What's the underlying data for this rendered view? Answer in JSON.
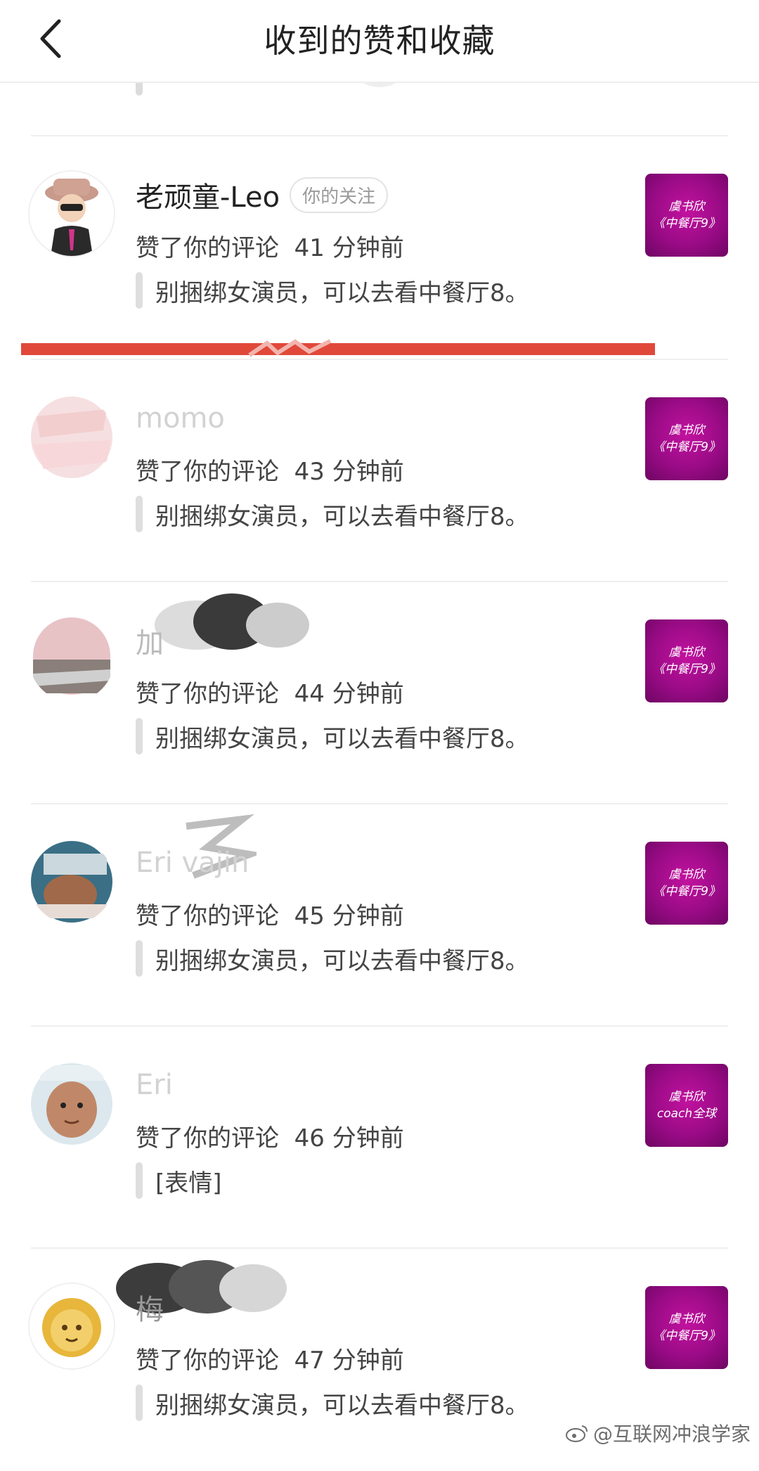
{
  "header": {
    "title": "收到的赞和收藏"
  },
  "top_remnant": {
    "quote_text": ""
  },
  "notifications": [
    {
      "username": "老顽童-Leo",
      "badge": "你的关注",
      "action": "赞了你的评论",
      "time": "41 分钟前",
      "quote": "别捆绑女演员，可以去看中餐厅8。",
      "thumb_lines": [
        "虞书欣",
        "《中餐厅9》"
      ]
    },
    {
      "username": "momo",
      "badge": "",
      "action": "赞了你的评论",
      "time": "43 分钟前",
      "quote": "别捆绑女演员，可以去看中餐厅8。",
      "thumb_lines": [
        "虞书欣",
        "《中餐厅9》"
      ]
    },
    {
      "username": "加",
      "badge": "",
      "action": "赞了你的评论",
      "time": "44 分钟前",
      "quote": "别捆绑女演员，可以去看中餐厅8。",
      "thumb_lines": [
        "虞书欣",
        "《中餐厅9》"
      ]
    },
    {
      "username": "Eri    vajin",
      "badge": "",
      "action": "赞了你的评论",
      "time": "45 分钟前",
      "quote": "别捆绑女演员，可以去看中餐厅8。",
      "thumb_lines": [
        "虞书欣",
        "《中餐厅9》"
      ]
    },
    {
      "username": "Eri",
      "badge": "",
      "action": "赞了你的评论",
      "time": "46 分钟前",
      "quote": "[表情]",
      "thumb_lines": [
        "虞书欣",
        "coach全球"
      ]
    },
    {
      "username": "梅",
      "badge": "",
      "action": "赞了你的评论",
      "time": "47 分钟前",
      "quote": "别捆绑女演员，可以去看中餐厅8。",
      "thumb_lines": [
        "虞书欣",
        "《中餐厅9》"
      ]
    }
  ],
  "watermark": {
    "text": "@互联网冲浪学家"
  },
  "colors": {
    "accent_red": "#e0483a",
    "thumb_purple": "#9a0b86"
  }
}
